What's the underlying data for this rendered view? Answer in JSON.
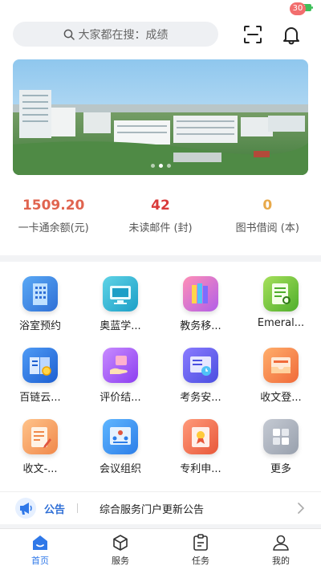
{
  "search": {
    "placeholder": "大家都在搜：成绩"
  },
  "notifications": {
    "badge": "30"
  },
  "stats": [
    {
      "value": "1509.20",
      "label": "一卡通余额(元)",
      "color": "#e0644f"
    },
    {
      "value": "42",
      "label": "未读邮件 (封)",
      "color": "#d93a3a"
    },
    {
      "value": "0",
      "label": "图书借阅 (本)",
      "color": "#e8a94a"
    }
  ],
  "apps": [
    {
      "label": "浴室预约",
      "icon": "building-icon"
    },
    {
      "label": "奥蓝学...",
      "icon": "monitor-icon"
    },
    {
      "label": "教务移...",
      "icon": "books-icon"
    },
    {
      "label": "Emeral...",
      "icon": "document-search-icon"
    },
    {
      "label": "百链云...",
      "icon": "book-search-icon"
    },
    {
      "label": "评价结...",
      "icon": "hand-card-icon"
    },
    {
      "label": "考务安...",
      "icon": "schedule-icon"
    },
    {
      "label": "收文登...",
      "icon": "inbox-icon"
    },
    {
      "label": "收文-...",
      "icon": "document-pen-icon"
    },
    {
      "label": "会议组织",
      "icon": "meeting-icon"
    },
    {
      "label": "专利申...",
      "icon": "patent-icon"
    },
    {
      "label": "更多",
      "icon": "more-icon"
    }
  ],
  "notice": {
    "tag": "公告",
    "text": "综合服务门户更新公告"
  },
  "tabs": [
    {
      "label": "首页",
      "active": true
    },
    {
      "label": "服务",
      "active": false
    },
    {
      "label": "任务",
      "active": false
    },
    {
      "label": "我的",
      "active": false
    }
  ]
}
